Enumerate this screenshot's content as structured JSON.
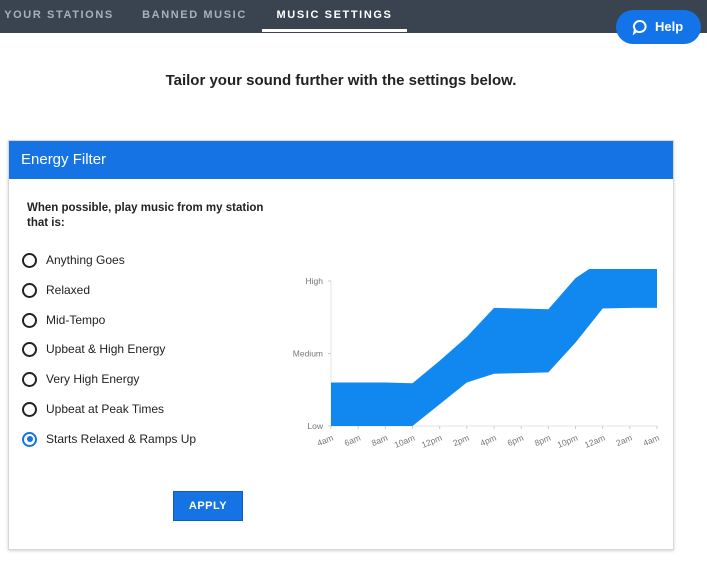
{
  "nav": {
    "tabs": [
      {
        "label": "YOUR STATIONS"
      },
      {
        "label": "BANNED MUSIC"
      },
      {
        "label": "MUSIC SETTINGS"
      }
    ],
    "help_label": "Help"
  },
  "tagline": "Tailor your sound further with the settings below.",
  "card": {
    "title": "Energy Filter",
    "prompt": "When possible, play music from my station that is:",
    "options": [
      {
        "label": "Anything Goes",
        "checked": false
      },
      {
        "label": "Relaxed",
        "checked": false
      },
      {
        "label": "Mid-Tempo",
        "checked": false
      },
      {
        "label": "Upbeat & High Energy",
        "checked": false
      },
      {
        "label": "Very High Energy",
        "checked": false
      },
      {
        "label": "Upbeat at Peak Times",
        "checked": false
      },
      {
        "label": "Starts Relaxed & Ramps Up",
        "checked": true
      }
    ],
    "apply_label": "APPLY"
  },
  "chart_data": {
    "type": "area",
    "x": [
      "4am",
      "6am",
      "8am",
      "10am",
      "12pm",
      "2pm",
      "4pm",
      "6pm",
      "8pm",
      "10pm",
      "12am",
      "2am",
      "4am"
    ],
    "y_categories": [
      "Low",
      "Medium",
      "High"
    ],
    "series": [
      {
        "upper": [
          0.6,
          0.6,
          0.6,
          0.59,
          0.9,
          1.23,
          1.63,
          1.62,
          1.61,
          2.04,
          2.29,
          2.29,
          2.29
        ],
        "lower": [
          0.0,
          0.0,
          0.0,
          0.0,
          0.3,
          0.6,
          0.72,
          0.73,
          0.74,
          1.15,
          1.62,
          1.63,
          1.63
        ]
      }
    ],
    "ylim": [
      0,
      2
    ],
    "color": "#1188f0",
    "grid": false
  }
}
